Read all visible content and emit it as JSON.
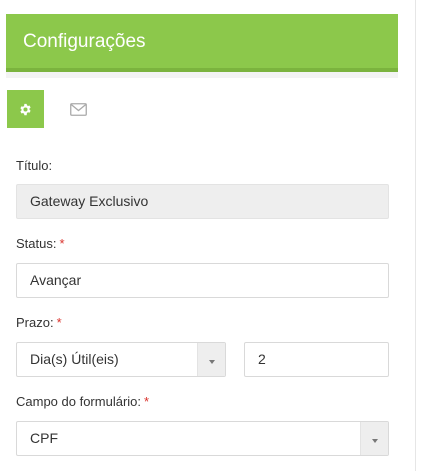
{
  "header": {
    "title": "Configurações"
  },
  "tabs": [
    {
      "icon": "gear-icon",
      "active": true
    },
    {
      "icon": "envelope-icon",
      "active": false
    }
  ],
  "form": {
    "titulo": {
      "label": "Título:",
      "value": "Gateway Exclusivo"
    },
    "status": {
      "label": "Status:",
      "required_mark": "*",
      "value": "Avançar"
    },
    "prazo": {
      "label": "Prazo:",
      "required_mark": "*",
      "unit_value": "Dia(s) Útil(eis)",
      "amount_value": "2"
    },
    "campo": {
      "label": "Campo do formulário:",
      "required_mark": "*",
      "value": "CPF"
    }
  },
  "colors": {
    "accent": "#8cc84b",
    "required": "#d9312b"
  }
}
